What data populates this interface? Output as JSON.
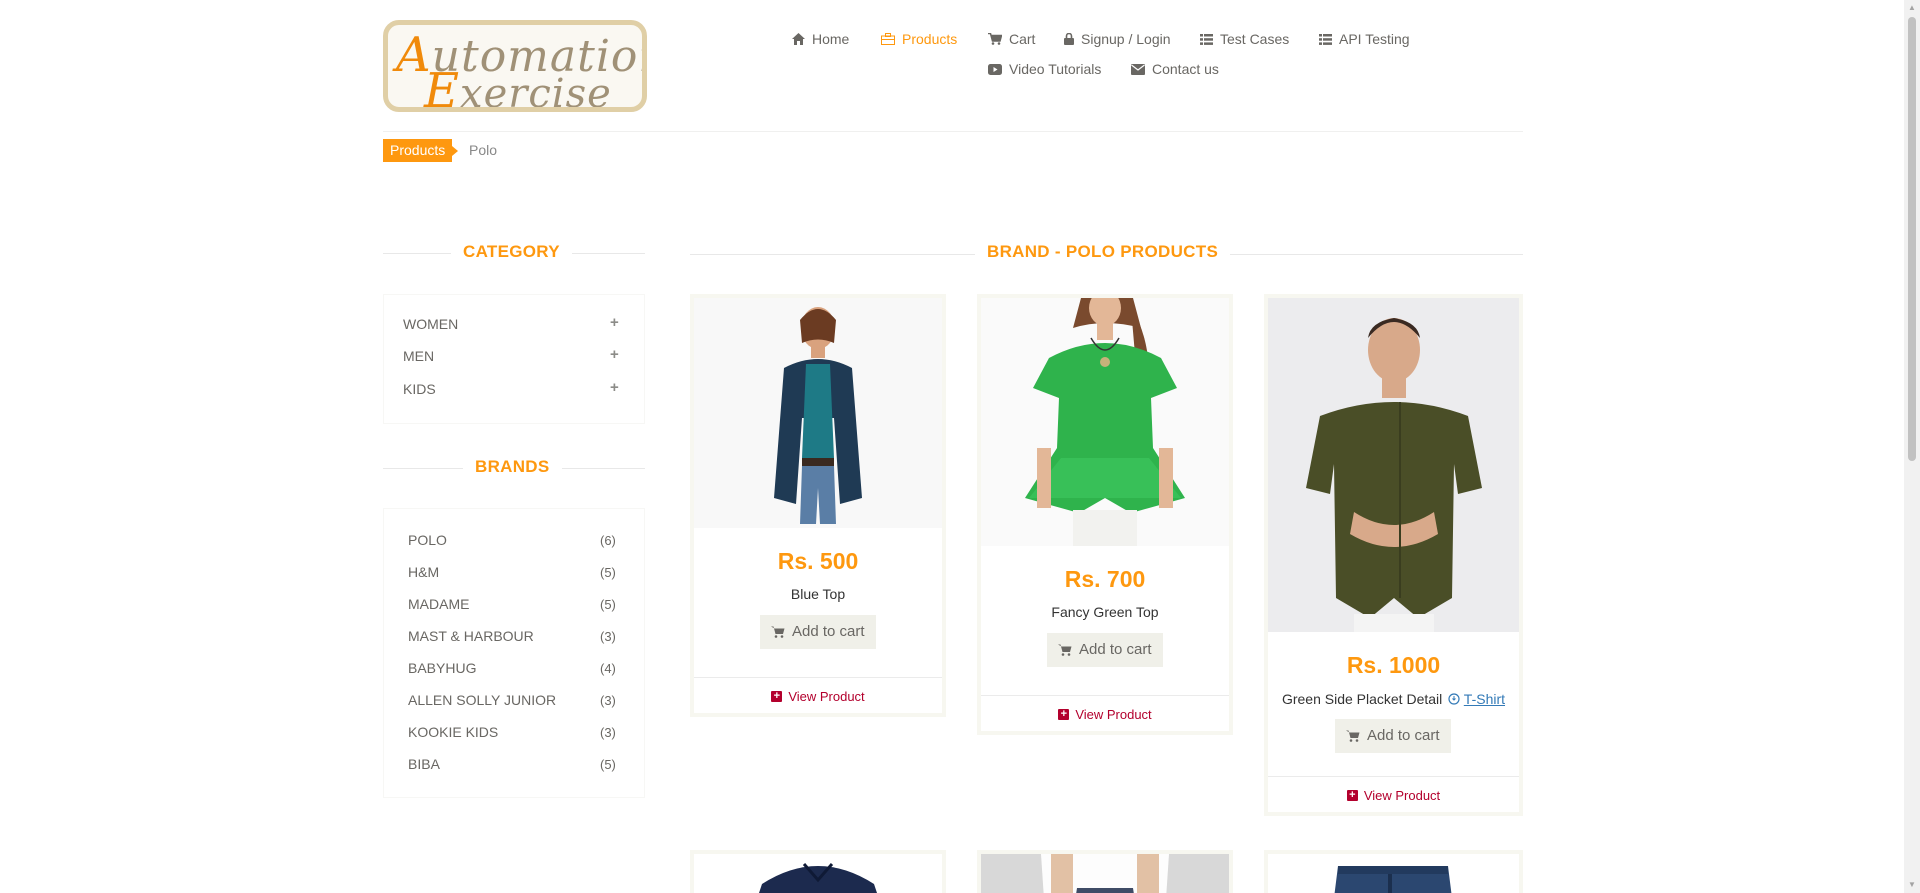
{
  "logo": {
    "line1_first": "A",
    "line1_rest": "utomation",
    "line2_first": "E",
    "line2_rest": "xercise"
  },
  "nav": {
    "home": "Home",
    "products": "Products",
    "cart": "Cart",
    "signup_login": "Signup / Login",
    "test_cases": "Test Cases",
    "api_testing": "API Testing",
    "video_tutorials": "Video Tutorials",
    "contact_us": "Contact us"
  },
  "breadcrumb": {
    "products": "Products",
    "current": "Polo"
  },
  "sidebar": {
    "category_title": "CATEGORY",
    "categories": [
      {
        "label": "WOMEN"
      },
      {
        "label": "MEN"
      },
      {
        "label": "KIDS"
      }
    ],
    "brands_title": "BRANDS",
    "brands": [
      {
        "name": "POLO",
        "count": "(6)"
      },
      {
        "name": "H&M",
        "count": "(5)"
      },
      {
        "name": "MADAME",
        "count": "(5)"
      },
      {
        "name": "MAST & HARBOUR",
        "count": "(3)"
      },
      {
        "name": "BABYHUG",
        "count": "(4)"
      },
      {
        "name": "ALLEN SOLLY JUNIOR",
        "count": "(3)"
      },
      {
        "name": "KOOKIE KIDS",
        "count": "(3)"
      },
      {
        "name": "BIBA",
        "count": "(5)"
      }
    ]
  },
  "main": {
    "title": "BRAND - POLO PRODUCTS",
    "add_to_cart_label": "Add to cart",
    "view_product_label": "View Product",
    "products": [
      {
        "price": "Rs. 500",
        "name": "Blue Top"
      },
      {
        "price": "Rs. 700",
        "name": "Fancy Green Top"
      },
      {
        "price": "Rs. 1000",
        "name": "Green Side Placket Detail",
        "tag": "T-Shirt"
      }
    ]
  },
  "colors": {
    "accent": "#FE980F",
    "view_link": "#B3002D",
    "cart_button_bg": "#F0F0E9"
  }
}
